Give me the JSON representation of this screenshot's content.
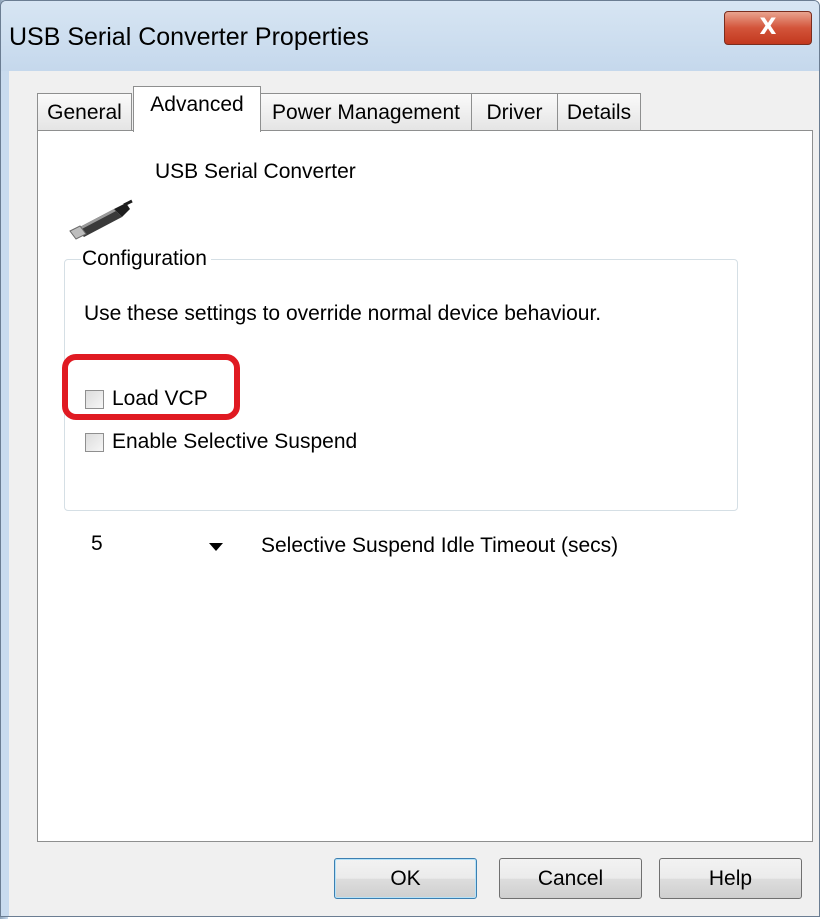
{
  "window": {
    "title": "USB Serial Converter Properties",
    "close_glyph": "X"
  },
  "tabs": [
    {
      "label": "General",
      "active": false
    },
    {
      "label": "Advanced",
      "active": true
    },
    {
      "label": "Power Management",
      "active": false
    },
    {
      "label": "Driver",
      "active": false
    },
    {
      "label": "Details",
      "active": false
    }
  ],
  "device": {
    "icon": "usb-plug-icon",
    "name": "USB Serial Converter"
  },
  "configuration": {
    "legend": "Configuration",
    "description": "Use these settings to override normal device behaviour.",
    "load_vcp": {
      "label": "Load VCP",
      "checked": false
    },
    "selective_suspend": {
      "label": "Enable Selective Suspend",
      "checked": false
    },
    "idle_timeout": {
      "value": "5",
      "label": "Selective Suspend Idle Timeout (secs)"
    }
  },
  "buttons": {
    "ok": "OK",
    "cancel": "Cancel",
    "help": "Help"
  },
  "colors": {
    "highlight": "#e01a22",
    "close_button": "#c2381e"
  }
}
